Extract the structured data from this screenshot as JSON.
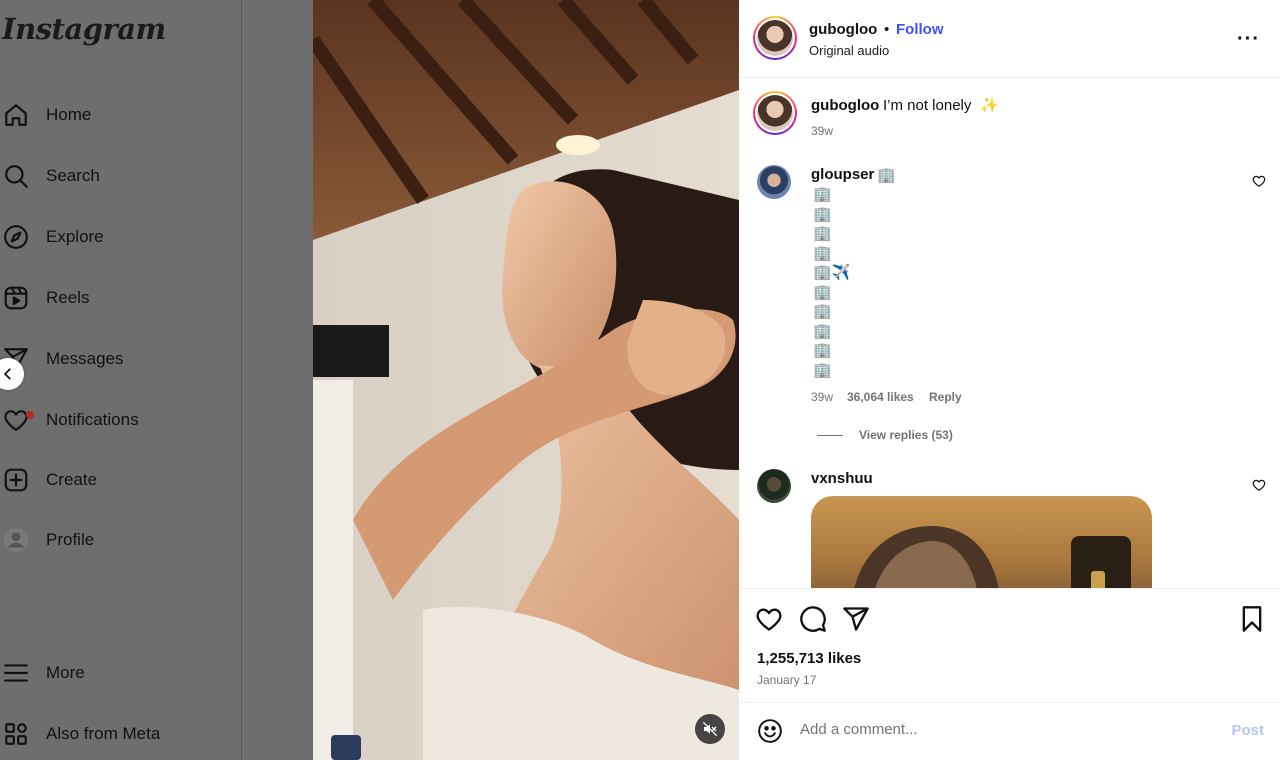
{
  "app": {
    "logo_text": "Instagram"
  },
  "sidebar": {
    "items": [
      {
        "label": "Home",
        "icon": "home-icon"
      },
      {
        "label": "Search",
        "icon": "search-icon"
      },
      {
        "label": "Explore",
        "icon": "explore-compass-icon"
      },
      {
        "label": "Reels",
        "icon": "reels-icon"
      },
      {
        "label": "Messages",
        "icon": "messages-send-icon"
      },
      {
        "label": "Notifications",
        "icon": "heart-icon",
        "has_badge": true
      },
      {
        "label": "Create",
        "icon": "plus-square-icon"
      },
      {
        "label": "Profile",
        "icon": "profile-avatar-icon"
      }
    ],
    "bottom_items": [
      {
        "label": "More",
        "icon": "hamburger-menu-icon"
      },
      {
        "label": "Also from Meta",
        "icon": "meta-grid-icon"
      }
    ]
  },
  "post": {
    "author": "gubogloo",
    "separator": "•",
    "follow_label": "Follow",
    "audio": "Original audio",
    "caption": {
      "username": "gubogloo",
      "text": "I’m not lonely",
      "emoji": "✨",
      "age": "39w"
    },
    "comments": [
      {
        "username": "gloupser",
        "header_emoji": "🏢",
        "lines": [
          "🏢",
          "🏢",
          "🏢",
          "🏢",
          "🏢✈️",
          "🏢",
          "🏢",
          "🏢",
          "🏢",
          "🏢"
        ],
        "age": "39w",
        "likes": "36,064 likes",
        "reply_label": "Reply",
        "view_replies": "View replies (53)"
      },
      {
        "username": "vxnshuu",
        "has_gif": true
      }
    ],
    "likes_total": "1,255,713 likes",
    "date": "January 17",
    "comment_placeholder": "Add a comment...",
    "post_label": "Post"
  },
  "colors": {
    "follow_blue": "#4150f7",
    "post_disabled": "#b3c6f7",
    "notification_badge": "#b22a2a",
    "dim_overlay": "#6e6e6e"
  }
}
